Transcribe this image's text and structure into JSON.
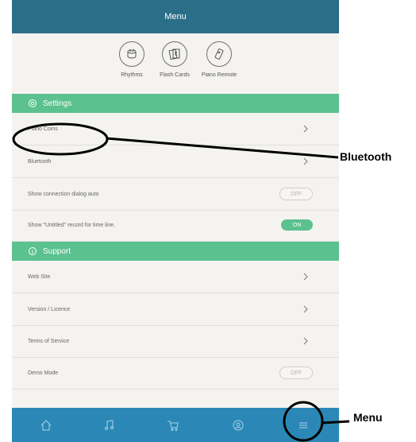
{
  "header": {
    "title": "Menu"
  },
  "quick_icons": [
    {
      "label": "Rhythms",
      "icon": "drum-icon"
    },
    {
      "label": "Flash Cards",
      "icon": "flash-cards-icon"
    },
    {
      "label": "Piano Remote",
      "icon": "remote-icon"
    }
  ],
  "settings": {
    "title": "Settings",
    "items": [
      {
        "label": "Piano Coins",
        "type": "link"
      },
      {
        "label": "Bluetooth",
        "type": "link"
      },
      {
        "label": "Show connection dialog auto",
        "type": "toggle",
        "value": "OFF"
      },
      {
        "label": "Show \"Untitled\" record for time line.",
        "type": "toggle",
        "value": "ON"
      }
    ]
  },
  "support": {
    "title": "Support",
    "items": [
      {
        "label": "Web Site",
        "type": "link"
      },
      {
        "label": "Version / Licence",
        "type": "link"
      },
      {
        "label": "Terms of Service",
        "type": "link"
      },
      {
        "label": "Demo Mode",
        "type": "toggle",
        "value": "OFF"
      }
    ]
  },
  "bottom_tabs": [
    "home-icon",
    "music-note-icon",
    "cart-icon",
    "user-icon",
    "menu-icon"
  ],
  "callouts": {
    "bluetooth": "Bluetooth",
    "menu": "Menu"
  },
  "colors": {
    "header": "#2b6e88",
    "section": "#5bc18f",
    "tabbar": "#2b88b6",
    "background": "#f4f3f0"
  }
}
